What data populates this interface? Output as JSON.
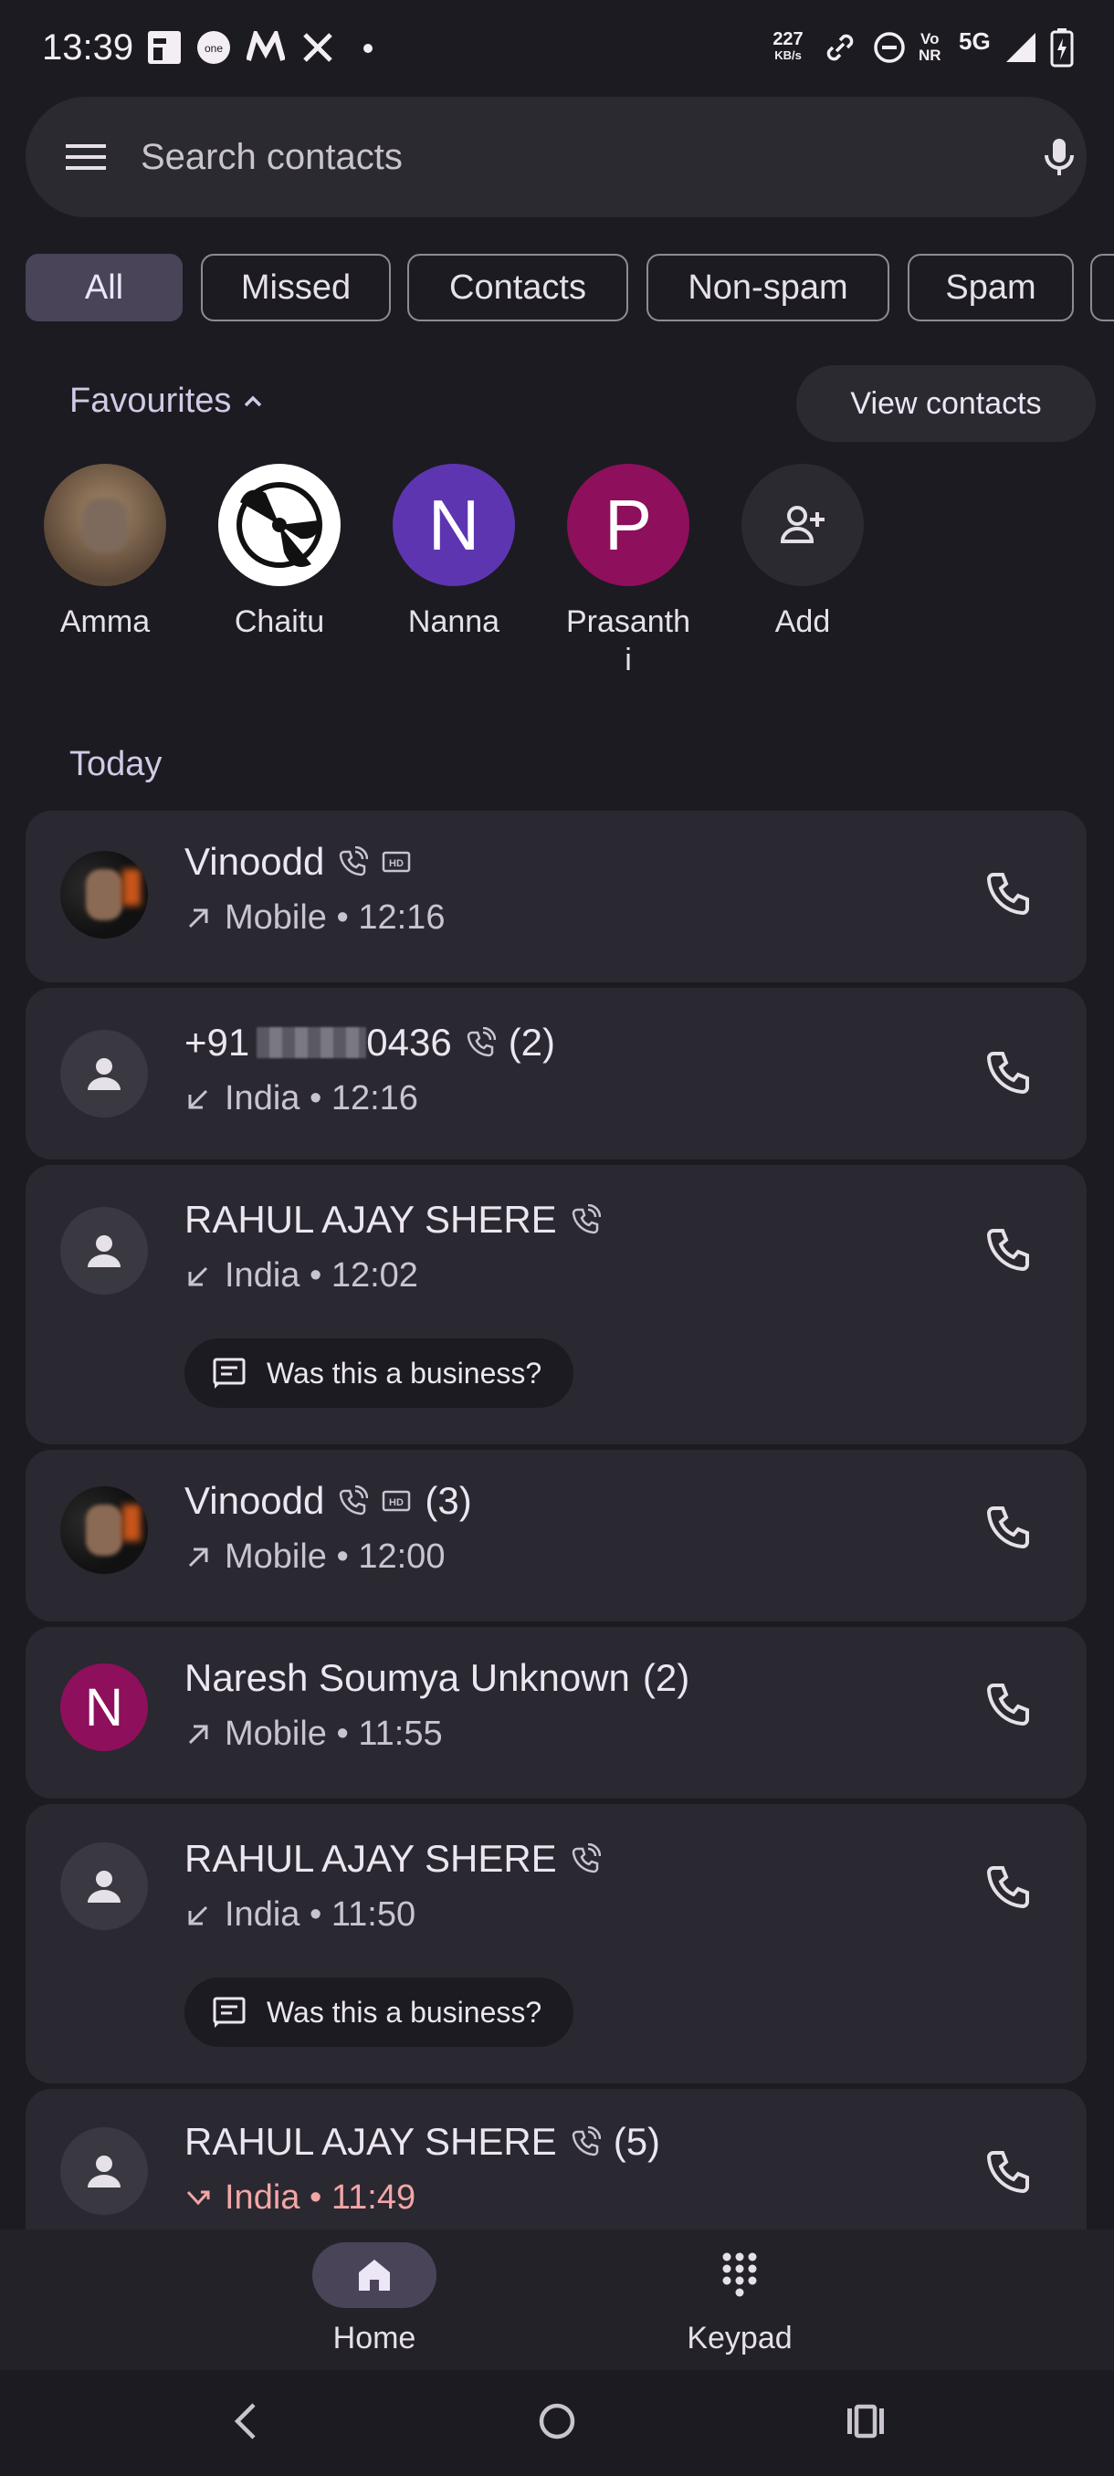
{
  "status_bar": {
    "time": "13:39",
    "speed_value": "227",
    "speed_unit": "KB/s",
    "network": "5G"
  },
  "search": {
    "placeholder": "Search contacts",
    "menu_icon": "hamburger-menu-icon",
    "mic_icon": "microphone-icon"
  },
  "filters": [
    "All",
    "Missed",
    "Contacts",
    "Non-spam",
    "Spam"
  ],
  "filter_selected": "All",
  "favourites": {
    "title": "Favourites",
    "view_contacts": "View contacts",
    "items": [
      {
        "name": "Amma",
        "initial": "",
        "color": "#6b5a49"
      },
      {
        "name": "Chaitu",
        "initial": "",
        "color": "#ffffff"
      },
      {
        "name": "Nanna",
        "initial": "N",
        "color": "#5e35b1"
      },
      {
        "name": "Prasanthi",
        "initial": "P",
        "color": "#8e0f5b"
      },
      {
        "name": "Add",
        "initial": "",
        "color": "#2c2a31"
      }
    ]
  },
  "section_today": "Today",
  "calls": [
    {
      "name": "Vinoodd",
      "count": "",
      "hd": true,
      "detail": "Mobile • 12:16",
      "direction": "outgoing"
    },
    {
      "name": "+91 ",
      "name_tail": "0436",
      "count": "(2)",
      "hd": false,
      "detail": "India • 12:16",
      "direction": "incoming"
    },
    {
      "name": "RAHUL AJAY SHERE",
      "count": "",
      "hd": false,
      "detail": "India • 12:02",
      "direction": "incoming",
      "business_prompt": "Was this a business?"
    },
    {
      "name": "Vinoodd",
      "count": "(3)",
      "hd": true,
      "detail": "Mobile • 12:00",
      "direction": "outgoing"
    },
    {
      "name": "Naresh Soumya Unknown",
      "count": "(2)",
      "hd": false,
      "detail": "Mobile • 11:55",
      "direction": "outgoing",
      "initial": "N"
    },
    {
      "name": "RAHUL AJAY SHERE",
      "count": "",
      "hd": false,
      "detail": "India • 11:50",
      "direction": "incoming",
      "business_prompt": "Was this a business?"
    },
    {
      "name": "RAHUL AJAY SHERE",
      "count": "(5)",
      "hd": false,
      "detail": "India • 11:49",
      "direction": "missed"
    }
  ],
  "bottom_nav": {
    "home": "Home",
    "keypad": "Keypad"
  },
  "colors": {
    "background": "#1c1b21",
    "card": "#2a2830",
    "accent": "#4a4459",
    "missed": "#f2a6a6"
  }
}
